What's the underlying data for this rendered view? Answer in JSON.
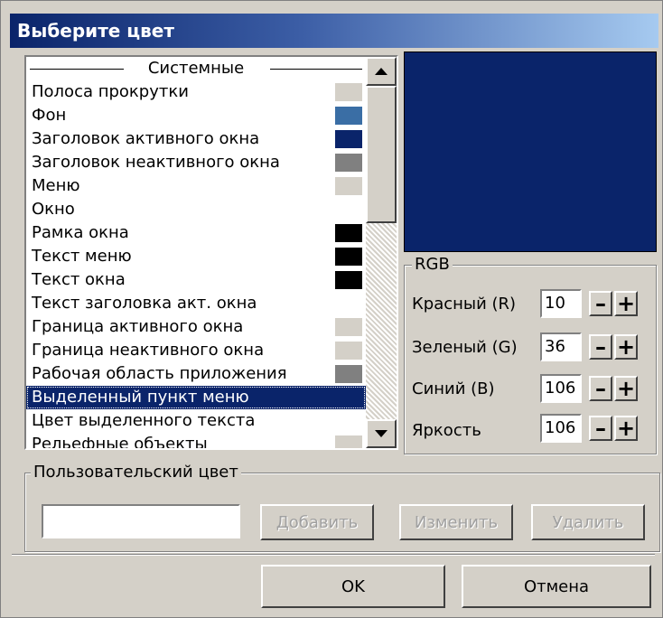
{
  "dialog": {
    "title": "Выберите цвет"
  },
  "list": {
    "section_header": "Системные",
    "items": [
      {
        "label": "Полоса прокрутки",
        "swatch": "#d4d0c8"
      },
      {
        "label": "Фон",
        "swatch": "#3a6ea5"
      },
      {
        "label": "Заголовок активного окна",
        "swatch": "#0a246a"
      },
      {
        "label": "Заголовок неактивного окна",
        "swatch": "#808080"
      },
      {
        "label": "Меню",
        "swatch": "#d4d0c8"
      },
      {
        "label": "Окно",
        "swatch": "#ffffff"
      },
      {
        "label": "Рамка окна",
        "swatch": "#000000"
      },
      {
        "label": "Текст меню",
        "swatch": "#000000"
      },
      {
        "label": "Текст окна",
        "swatch": "#000000"
      },
      {
        "label": "Текст заголовка акт. окна",
        "swatch": "#ffffff"
      },
      {
        "label": "Граница активного окна",
        "swatch": "#d4d0c8"
      },
      {
        "label": "Граница неактивного окна",
        "swatch": "#d4d0c8"
      },
      {
        "label": "Рабочая область приложения",
        "swatch": "#808080"
      },
      {
        "label": "Выделенный пункт меню",
        "swatch": "#0a246a",
        "selected": true
      },
      {
        "label": "Цвет выделенного текста",
        "swatch": "#ffffff"
      },
      {
        "label": "Рельефные объекты",
        "swatch": "#d4d0c8"
      }
    ]
  },
  "preview": {
    "color": "#0a246a"
  },
  "rgb": {
    "group_title": "RGB",
    "red_label": "Красный (R)",
    "red_value": "10",
    "green_label": "Зеленый (G)",
    "green_value": "36",
    "blue_label": "Синий (B)",
    "blue_value": "106",
    "brightness_label": "Яркость",
    "brightness_value": "106",
    "minus": "–",
    "plus": "+"
  },
  "custom": {
    "group_title": "Пользовательский цвет",
    "input_value": "",
    "add_label": "Добавить",
    "edit_label": "Изменить",
    "delete_label": "Удалить"
  },
  "footer": {
    "ok_label": "OK",
    "cancel_label": "Отмена"
  }
}
